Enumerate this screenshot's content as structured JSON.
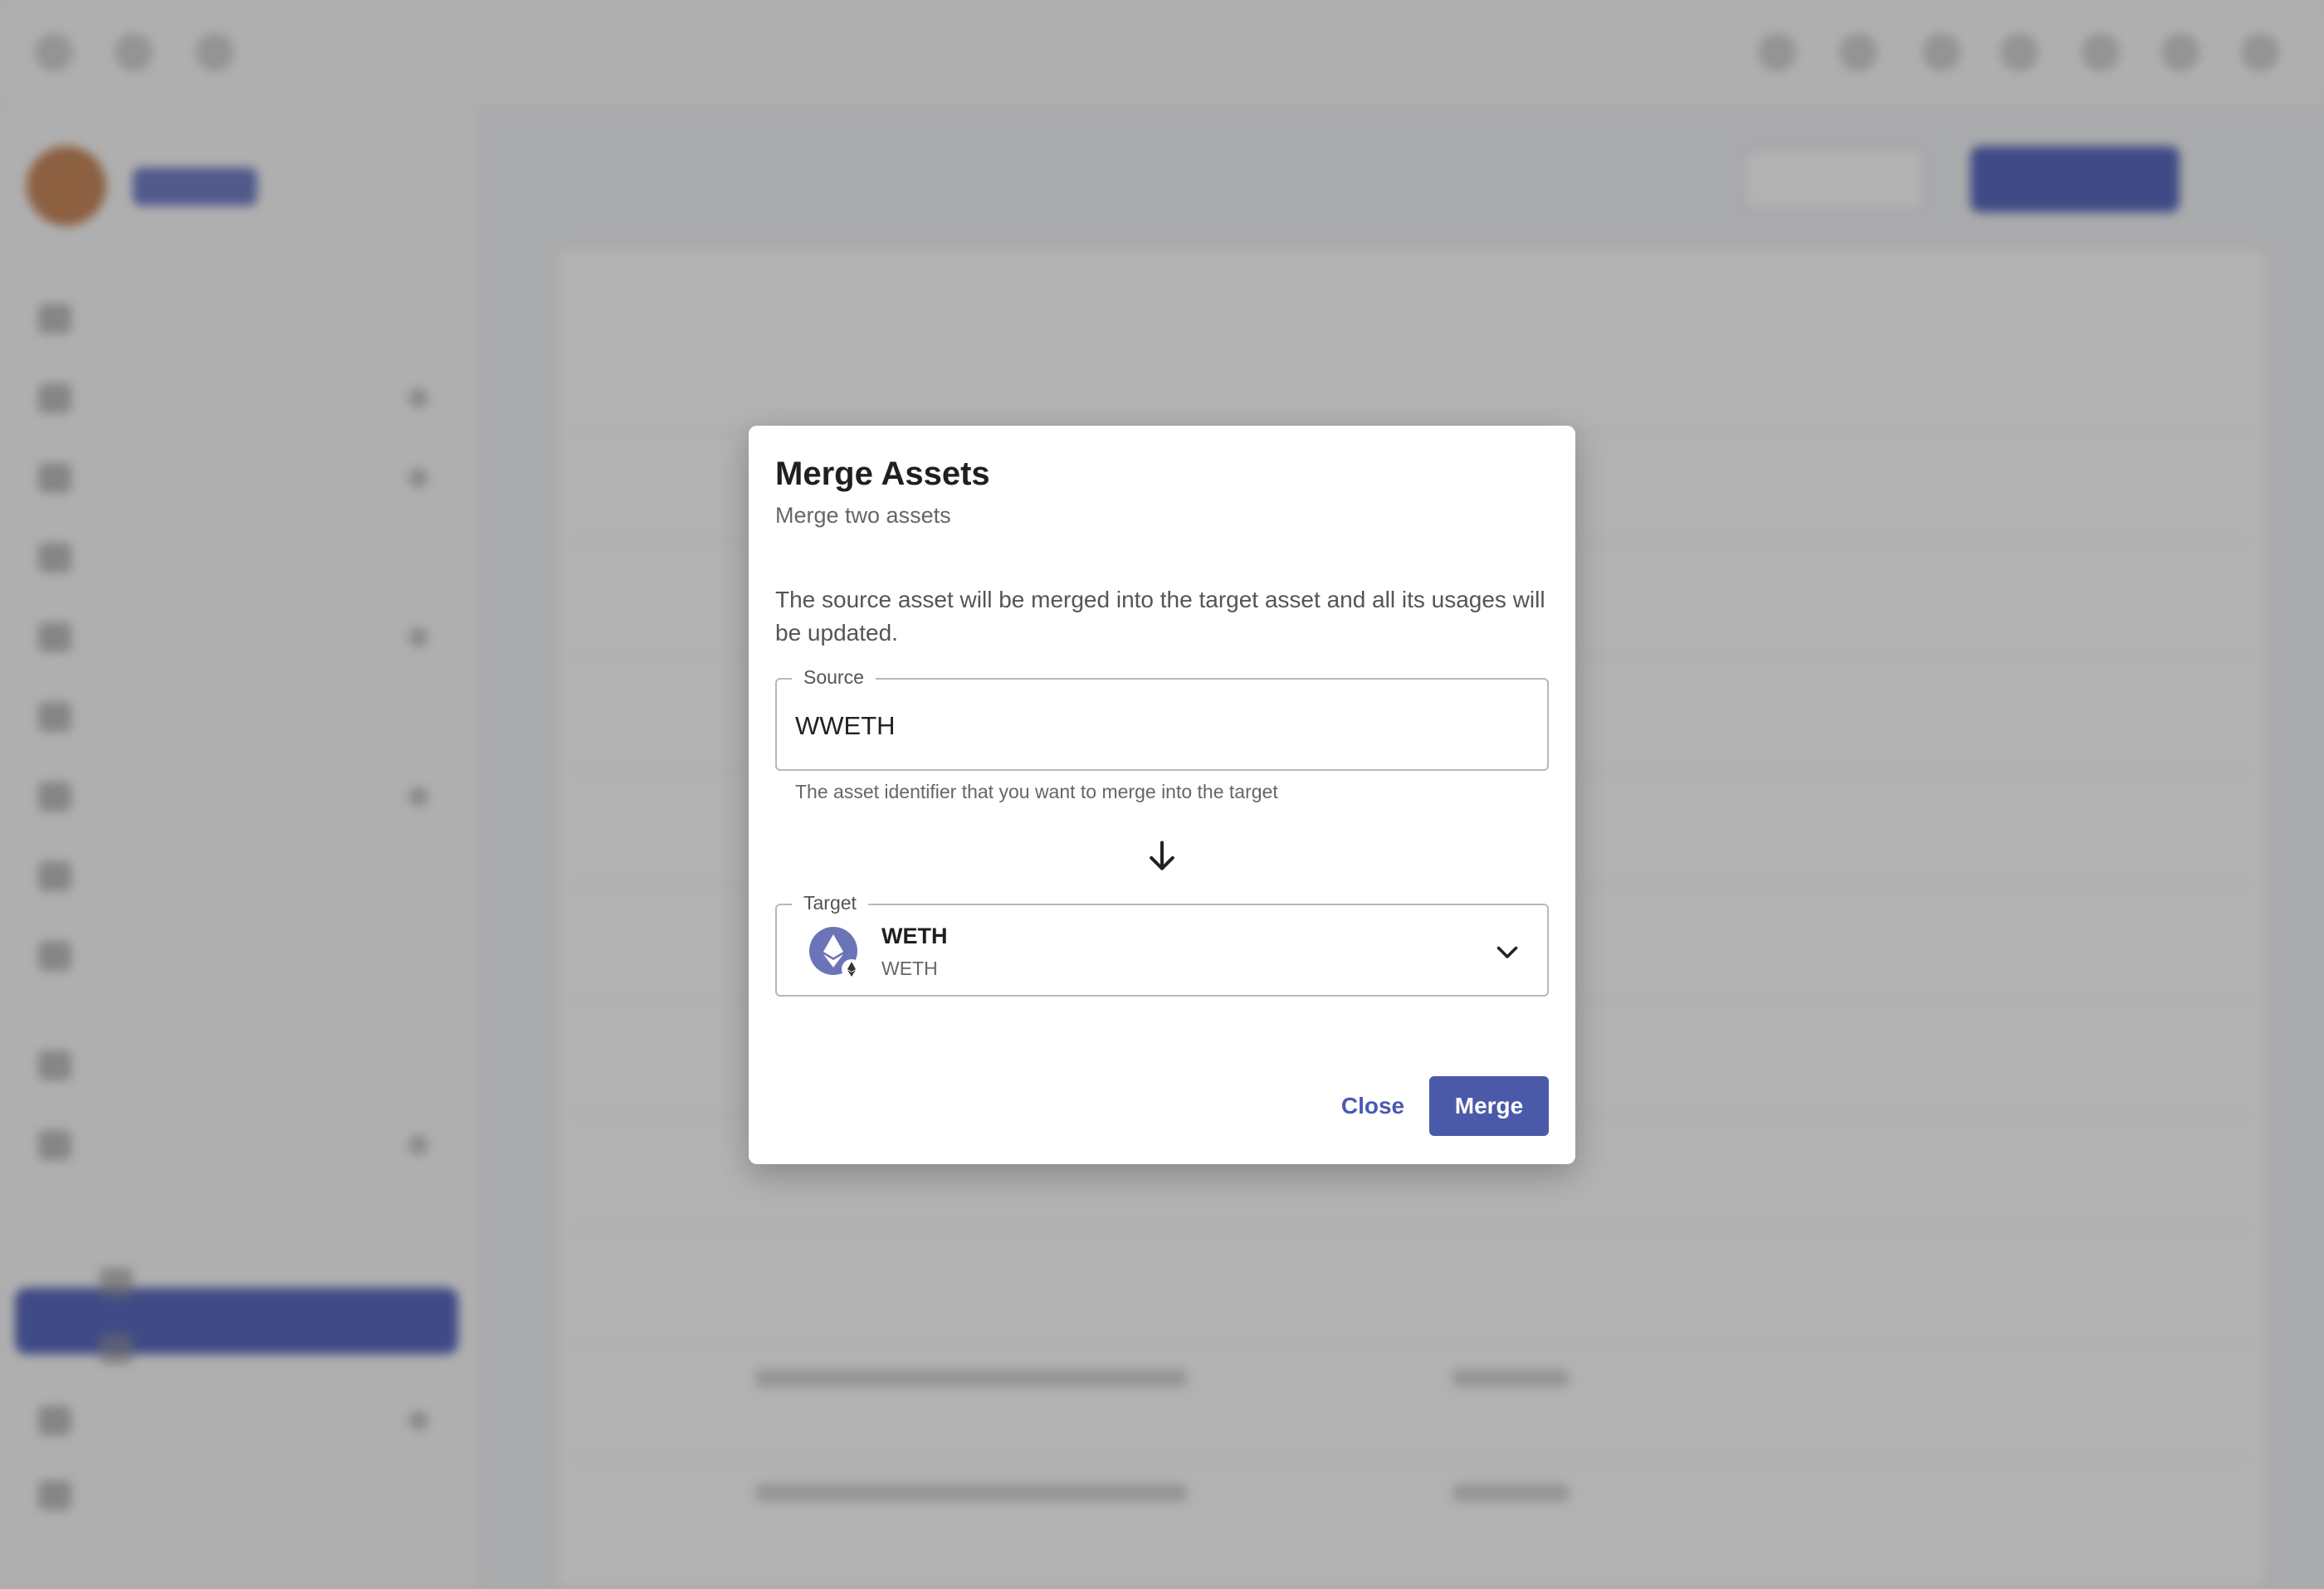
{
  "dialog": {
    "title": "Merge Assets",
    "subtitle": "Merge two assets",
    "description": "The source asset will be merged into the target asset and all its usages will be updated.",
    "source": {
      "label": "Source",
      "value": "WWETH",
      "hint": "The asset identifier that you want to merge into the target"
    },
    "target": {
      "label": "Target",
      "name": "WETH",
      "symbol": "WETH",
      "icon": "ethereum-icon"
    },
    "buttons": {
      "close": "Close",
      "merge": "Merge"
    }
  },
  "colors": {
    "accent": "#4a5aa8",
    "accent_text": "#4a59b5",
    "eth_icon": "#6c74b8"
  }
}
